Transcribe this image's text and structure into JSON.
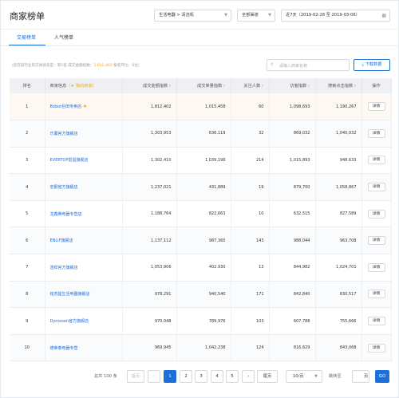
{
  "header": {
    "title": "商家榜单",
    "category": "生活电器 > 清洁机",
    "channel": "全部渠道",
    "date_range": "近7天（2019-02-28 至 2019-03-06）"
  },
  "tabs": [
    {
      "label": "交易榜单",
      "active": true
    },
    {
      "label": "人气榜单",
      "active": false
    }
  ],
  "summary": {
    "prefix": "（您在该行业的交易排名是：第1名  成交金额指数：",
    "amount": "1,812,402",
    "suffix": "  排名环比：0位）"
  },
  "search": {
    "placeholder": "请输入商家名称",
    "icon": "search-icon"
  },
  "download_label": "下载数据",
  "table": {
    "headers": {
      "rank": "排名",
      "shop": "商家信息",
      "my_shop": "（★ 我的商家）",
      "amount": "成交金额指数",
      "unit_price": "成交单量指数",
      "followers": "关注人数",
      "visits": "访客指数",
      "clicks": "搜索点击指数",
      "action": "操作"
    },
    "rows": [
      {
        "rank": "1",
        "shop": "Bobot巨田专卖店",
        "mine": "★",
        "amount": "1,812,402",
        "unit": "1,015,458",
        "followers": "60",
        "visits": "1,098,693",
        "clicks": "1,190,267",
        "action": "详情"
      },
      {
        "rank": "2",
        "shop": "乐薯官方旗舰店",
        "mine": "",
        "amount": "1,303,953",
        "unit": "636,119",
        "followers": "32",
        "visits": "869,032",
        "clicks": "1,040,032",
        "action": "详情"
      },
      {
        "rank": "3",
        "shop": "EVERTOP雷蛋旗舰店",
        "mine": "",
        "amount": "1,302,410",
        "unit": "1,039,198",
        "followers": "214",
        "visits": "1,015,893",
        "clicks": "948,633",
        "action": "详情"
      },
      {
        "rank": "4",
        "shop": "忠爵官方旗舰店",
        "mine": "",
        "amount": "1,237,021",
        "unit": "431,889",
        "followers": "19",
        "visits": "879,700",
        "clicks": "1,058,867",
        "action": "详情"
      },
      {
        "rank": "5",
        "shop": "龙鑫腾电器专营店",
        "mine": "",
        "amount": "1,188,764",
        "unit": "822,663",
        "followers": "10",
        "visits": "632,515",
        "clicks": "827,589",
        "action": "详情"
      },
      {
        "rank": "6",
        "shop": "ENLiF旗舰店",
        "mine": "",
        "amount": "1,137,112",
        "unit": "987,365",
        "followers": "143",
        "visits": "988,044",
        "clicks": "963,708",
        "action": "详情"
      },
      {
        "rank": "7",
        "shop": "渲铧官方旗舰店",
        "mine": "",
        "amount": "1,053,906",
        "unit": "402,930",
        "followers": "13",
        "visits": "844,982",
        "clicks": "1,024,701",
        "action": "详情"
      },
      {
        "rank": "8",
        "shop": "帕苏提生活电器旗舰店",
        "mine": "",
        "amount": "978,291",
        "unit": "940,540",
        "followers": "171",
        "visits": "842,840",
        "clicks": "830,517",
        "action": "详情"
      },
      {
        "rank": "9",
        "shop": "Dymosen官方旗舰店",
        "mine": "",
        "amount": "970,048",
        "unit": "789,976",
        "followers": "103",
        "visits": "607,788",
        "clicks": "755,666",
        "action": "详情"
      },
      {
        "rank": "10",
        "shop": "德荣泰电器专营",
        "mine": "",
        "amount": "969,945",
        "unit": "1,042,238",
        "followers": "124",
        "visits": "816,629",
        "clicks": "843,068",
        "action": "详情"
      }
    ]
  },
  "pagination": {
    "total": "总共 100 条",
    "prev": "首页",
    "pages": [
      "1",
      "2",
      "3",
      "4",
      "5"
    ],
    "next_arrow": "›",
    "prev_arrow": "‹",
    "last": "尾页",
    "page_size": "10/页",
    "jump_label": "跳转至",
    "page_unit": "页",
    "go": "GO",
    "current_page": 1
  },
  "colors": {
    "accent": "#1e6fd9",
    "highlight": "#f5a623"
  }
}
